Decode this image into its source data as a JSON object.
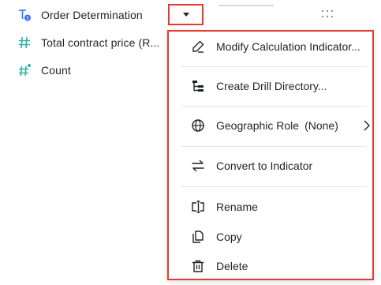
{
  "fields": [
    {
      "icon": "text-formula-icon",
      "label": "Order Determination"
    },
    {
      "icon": "hash-icon",
      "label": "Total contract price (R..."
    },
    {
      "icon": "hash-calculated-icon",
      "label": "Count"
    }
  ],
  "dropdown": {
    "icon": "caret-down-icon"
  },
  "menu": {
    "items": [
      {
        "icon": "edit-icon",
        "label": "Modify Calculation Indicator..."
      },
      {
        "icon": "drill-hierarchy-icon",
        "label": "Create Drill Directory..."
      },
      {
        "icon": "globe-icon",
        "label": "Geographic Role",
        "value": "(None)",
        "has_submenu": true
      },
      {
        "icon": "convert-arrows-icon",
        "label": "Convert to Indicator"
      },
      {
        "icon": "rename-icon",
        "label": "Rename"
      },
      {
        "icon": "copy-icon",
        "label": "Copy"
      },
      {
        "icon": "trash-icon",
        "label": "Delete"
      }
    ]
  },
  "colors": {
    "field_icon_teal": "#2bb3a3",
    "field_icon_blue": "#3370ff",
    "highlight_red": "#e53935"
  }
}
